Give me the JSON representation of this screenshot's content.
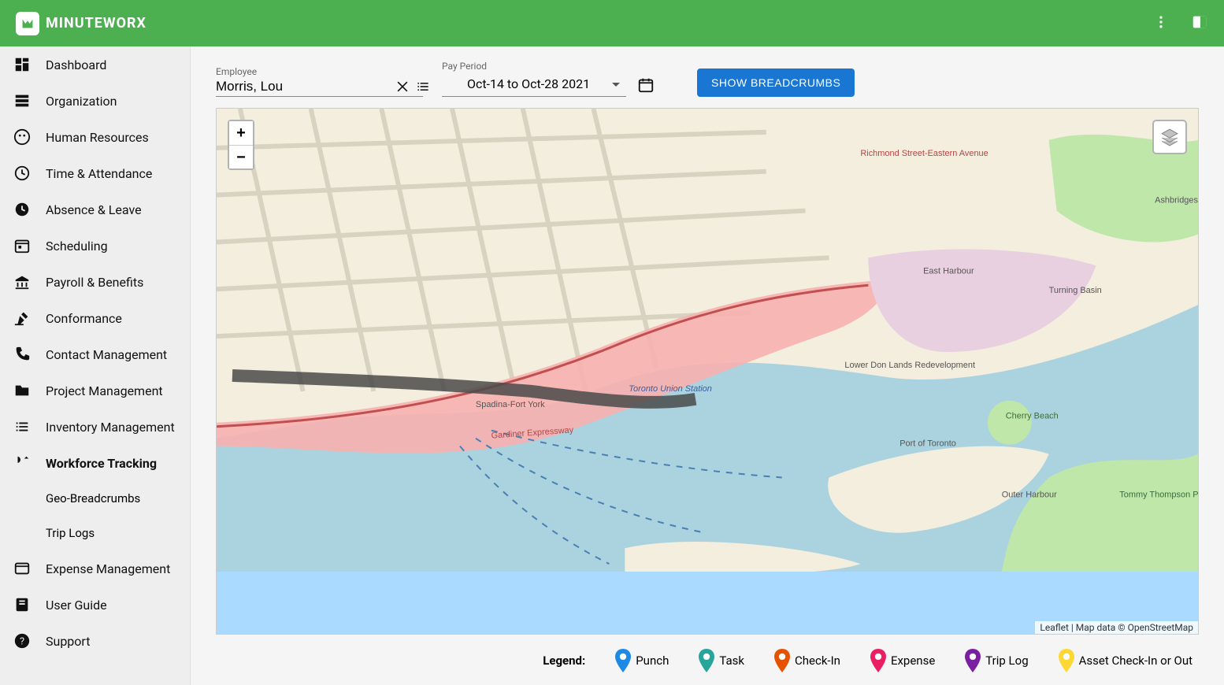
{
  "header": {
    "brand": "MINUTEWORX"
  },
  "sidebar": {
    "items": [
      {
        "label": "Dashboard"
      },
      {
        "label": "Organization"
      },
      {
        "label": "Human Resources"
      },
      {
        "label": "Time & Attendance"
      },
      {
        "label": "Absence & Leave"
      },
      {
        "label": "Scheduling"
      },
      {
        "label": "Payroll & Benefits"
      },
      {
        "label": "Conformance"
      },
      {
        "label": "Contact Management"
      },
      {
        "label": "Project Management"
      },
      {
        "label": "Inventory Management"
      },
      {
        "label": "Workforce Tracking"
      },
      {
        "label": "Expense Management"
      },
      {
        "label": "User Guide"
      },
      {
        "label": "Support"
      }
    ],
    "workforce_sub": [
      {
        "label": "Geo-Breadcrumbs"
      },
      {
        "label": "Trip Logs"
      }
    ]
  },
  "controls": {
    "employee_label": "Employee",
    "employee_value": "Morris, Lou",
    "pay_period_label": "Pay Period",
    "pay_period_value": "Oct-14 to Oct-28 2021",
    "show_button": "SHOW BREADCRUMBS"
  },
  "map": {
    "zoom_in": "+",
    "zoom_out": "−",
    "attribution": "Leaflet | Map data © OpenStreetMap"
  },
  "legend": {
    "title": "Legend:",
    "items": [
      {
        "label": "Punch",
        "color": "#1E88E5"
      },
      {
        "label": "Task",
        "color": "#26A69A"
      },
      {
        "label": "Check-In",
        "color": "#E65100"
      },
      {
        "label": "Expense",
        "color": "#E91E63"
      },
      {
        "label": "Trip Log",
        "color": "#7B1FA2"
      },
      {
        "label": "Asset Check-In or Out",
        "color": "#FDD835"
      }
    ]
  }
}
